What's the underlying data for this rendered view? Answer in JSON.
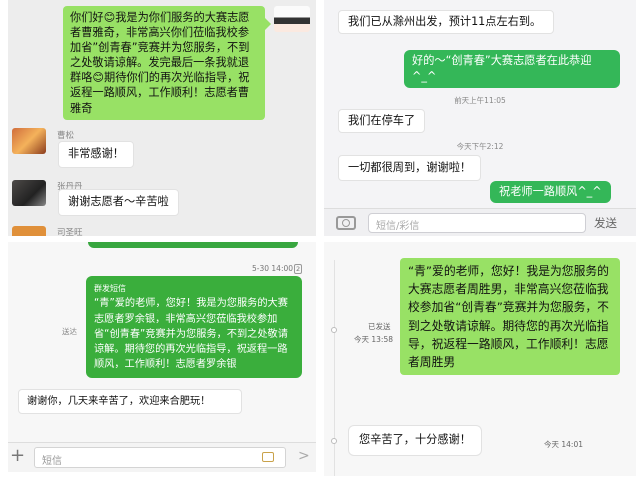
{
  "panel1": {
    "message_self": "你们好😊我是为你们服务的大赛志愿者曹雅奇，非常高兴你们莅临我校参加省”创青春”竞赛并为您服务，不到之处敬请谅解。发完最后一条我就退群咯😊期待你们的再次光临指导，祝返程一路顺风，工作顺利！志愿者曹雅奇",
    "user1_name": "曹松",
    "user1_message": "非常感谢！",
    "user2_name": "张丹丹",
    "user2_message": "谢谢志愿者～辛苦啦",
    "user3_name": "司圣旺"
  },
  "panel2": {
    "msg1": "我们已从滁州出发，预计11点左右到。",
    "msg2": "好的～“创青春”大赛志愿者在此恭迎^_^",
    "time1": "前天上午11:05",
    "msg3": "我们在停车了",
    "time2": "今天下午2:12",
    "msg4": "一切都很周到，谢谢啦！",
    "msg5": "祝老师一路顺风^_^",
    "input_placeholder": "短信/彩信",
    "send_label": "发送"
  },
  "panel3": {
    "timestamp": "5-30 14:00",
    "timestamp_badge": "2",
    "group_label": "群发短信",
    "msg1": "“青”爱的老师，您好！我是为您服务的大赛志愿者罗余银，非常高兴您莅临我校参加省“创青春”竞赛并为您服务，不到之处敬请谅解。期待您的再次光临指导，祝返程一路顺风，工作顺利！志愿者罗余银",
    "sent_label": "送达",
    "msg2": "谢谢你，几天来辛苦了，欢迎来合肥玩！",
    "input_placeholder": "短信"
  },
  "panel4": {
    "msg1": "“青”爱的老师，您好！我是为您服务的大赛志愿者周胜男，非常高兴您莅临我校参加省“创青春”竞赛并为您服务，不到之处敬请谅解。期待您的再次光临指导，祝返程一路顺风，工作顺利！志愿者周胜男",
    "status1": "已发送",
    "time1": "今天 13:58",
    "msg2": "您辛苦了，十分感谢！",
    "time2": "今天 14:01"
  }
}
